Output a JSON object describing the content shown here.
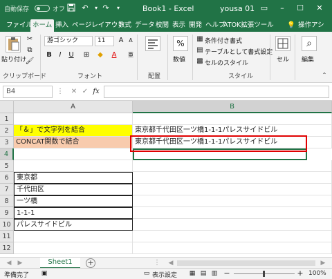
{
  "titlebar": {
    "autosave": "自動保存",
    "autosave_state": "オフ",
    "title": "Book1 - Excel",
    "user": "yousa 01"
  },
  "ribbon_tabs": [
    "ファイル",
    "ホーム",
    "挿入",
    "ページレイアウト",
    "数式",
    "データ",
    "校閲",
    "表示",
    "開発",
    "ヘルプ",
    "ATOK拡張ツール",
    "操作アシ"
  ],
  "active_tab": "ホーム",
  "ribbon": {
    "paste_label": "貼り付け",
    "clipboard_group": "クリップボード",
    "font_name": "游ゴシック",
    "font_size": "11",
    "font_group": "フォント",
    "align_group": "配置",
    "number_label": "数値",
    "cond_format": "条件付き書式",
    "table_format": "テーブルとして書式設定",
    "cell_style": "セルのスタイル",
    "style_group": "スタイル",
    "cell_label": "セル",
    "edit_label": "編集"
  },
  "formula_bar": {
    "name_box": "B4",
    "fx": "fx",
    "value": ""
  },
  "columns": [
    "A",
    "B"
  ],
  "rows": [
    "1",
    "2",
    "3",
    "4",
    "5",
    "6",
    "7",
    "8",
    "9",
    "10",
    "11",
    "12"
  ],
  "cells": {
    "A2": "「＆」で文字列を結合",
    "B2": "東京都千代田区一ツ橋1-1-1パレスサイドビル",
    "A3": "CONCAT関数で結合",
    "B3": "東京都千代田区一ツ橋1-1-1パレスサイドビル",
    "A6": "東京都",
    "A7": "千代田区",
    "A8": "一ツ橋",
    "A9": "1-1-1",
    "A10": "パレスサイドビル"
  },
  "sheet_tab": "Sheet1",
  "status": {
    "ready": "準備完了",
    "display_settings": "表示設定",
    "zoom": "100%"
  },
  "colors": {
    "excel_green": "#217346",
    "highlight_yellow": "#ffff00",
    "highlight_salmon": "#f8cbad",
    "annotation_red": "#e00000"
  }
}
